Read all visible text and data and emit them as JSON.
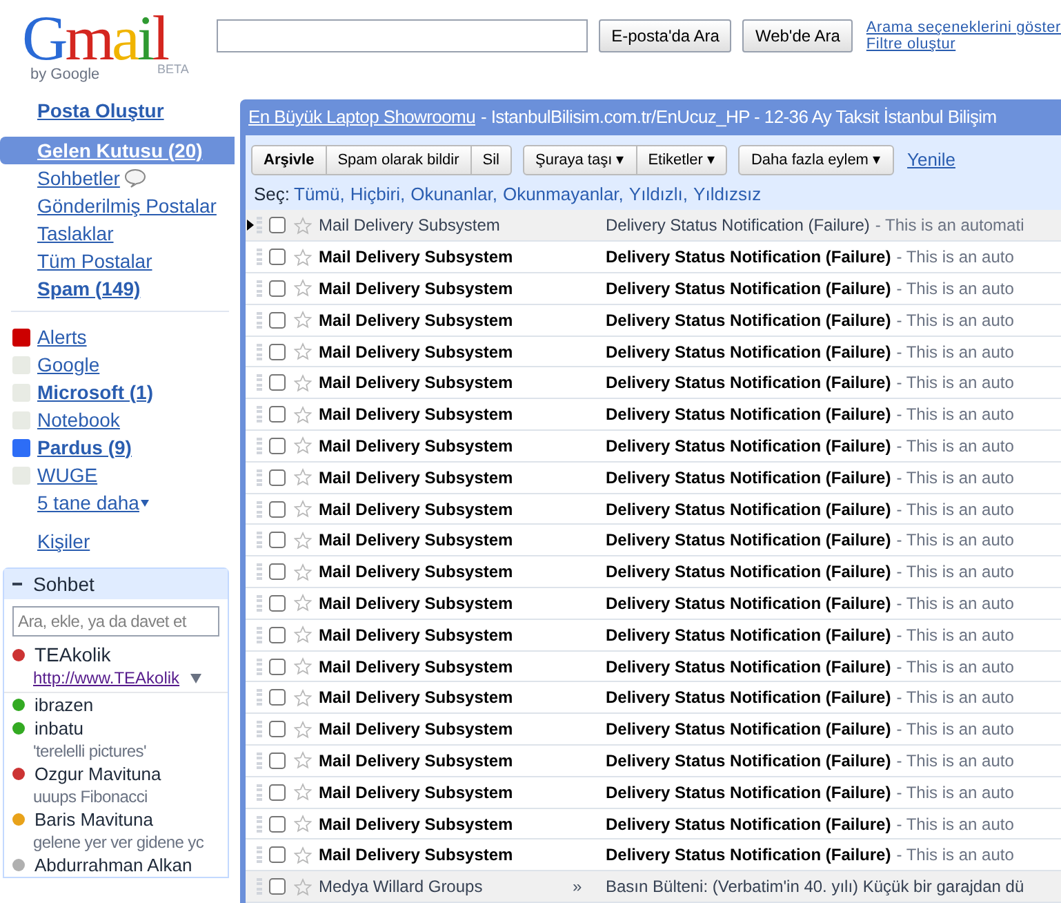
{
  "logo": {
    "text": "Gmail",
    "byline": "by Google",
    "badge": "BETA"
  },
  "search": {
    "buttons": [
      "E-posta'da Ara",
      "Web'de Ara"
    ],
    "links": [
      "Arama seçeneklerini göster",
      "Filtre oluştur"
    ]
  },
  "compose": "Posta Oluştur",
  "nav": [
    {
      "label": "Gelen Kutusu (20)",
      "bold": true,
      "selected": true,
      "kind": "folder"
    },
    {
      "label": "Sohbetler",
      "bold": false,
      "selected": false,
      "kind": "chat"
    },
    {
      "label": "Gönderilmiş Postalar",
      "bold": false,
      "selected": false,
      "kind": "folder"
    },
    {
      "label": "Taslaklar",
      "bold": false,
      "selected": false,
      "kind": "folder"
    },
    {
      "label": "Tüm Postalar",
      "bold": false,
      "selected": false,
      "kind": "folder"
    },
    {
      "label": "Spam (149)",
      "bold": true,
      "selected": false,
      "kind": "folder"
    }
  ],
  "labels": [
    {
      "label": "Alerts",
      "bold": false,
      "color": "#cc0000"
    },
    {
      "label": "Google",
      "bold": false,
      "color": "#e8ebe4"
    },
    {
      "label": "Microsoft (1)",
      "bold": true,
      "color": "#e8ebe4"
    },
    {
      "label": "Notebook",
      "bold": false,
      "color": "#e8ebe4"
    },
    {
      "label": "Pardus (9)",
      "bold": true,
      "color": "#2d6df6"
    },
    {
      "label": "WUGE",
      "bold": false,
      "color": "#e8ebe4"
    }
  ],
  "more_labels": "5 tane daha",
  "contacts_link": "Kişiler",
  "chat": {
    "title": "Sohbet",
    "expanded": true,
    "placeholder": "Ara, ekle, ya da davet et",
    "me": {
      "name": "TEAkolik",
      "color": "#cc3333",
      "status": "http://www.TEAkolik"
    },
    "contacts": [
      {
        "name": "ibrazen",
        "color": "#33aa22"
      },
      {
        "name": "inbatu",
        "color": "#33aa22",
        "status": "'terelelli pictures'"
      },
      {
        "name": "Ozgur Mavituna",
        "color": "#cc3333",
        "status": "uuups Fibonacci"
      },
      {
        "name": "Baris Mavituna",
        "color": "#e8a21a",
        "status": "gelene yer ver gidene yc"
      },
      {
        "name": "Abdurrahman Alkan",
        "color": "#b0b0b0"
      }
    ]
  },
  "ad": {
    "link": "En Büyük Laptop Showroomu",
    "text": "- IstanbulBilisim.com.tr/EnUcuz_HP - 12-36 Ay Taksit İstanbul Bilişim"
  },
  "toolbar": {
    "groups": [
      [
        "Arşivle",
        "Spam olarak bildir",
        "Sil"
      ],
      [
        "Şuraya taşı ▾",
        "Etiketler ▾"
      ],
      [
        "Daha fazla eylem ▾"
      ]
    ],
    "refresh": "Yenile"
  },
  "select": {
    "label": "Seç:",
    "options": [
      "Tümü,",
      "Hiçbiri,",
      "Okunanlar,",
      "Okunmayanlar,",
      "Yıldızlı,",
      "Yıldızsız"
    ]
  },
  "emails": [
    {
      "sender": "Mail Delivery Subsystem",
      "subject": "Delivery Status Notification (Failure)",
      "snippet": "- This is an automati",
      "unread": false,
      "current": true,
      "checked": false,
      "starred": false
    },
    {
      "sender": "Mail Delivery Subsystem",
      "subject": "Delivery Status Notification (Failure)",
      "snippet": "- This is an auto",
      "unread": true,
      "current": false,
      "checked": false,
      "starred": false
    },
    {
      "sender": "Mail Delivery Subsystem",
      "subject": "Delivery Status Notification (Failure)",
      "snippet": "- This is an auto",
      "unread": true,
      "current": false,
      "checked": false,
      "starred": false
    },
    {
      "sender": "Mail Delivery Subsystem",
      "subject": "Delivery Status Notification (Failure)",
      "snippet": "- This is an auto",
      "unread": true,
      "current": false,
      "checked": false,
      "starred": false
    },
    {
      "sender": "Mail Delivery Subsystem",
      "subject": "Delivery Status Notification (Failure)",
      "snippet": "- This is an auto",
      "unread": true,
      "current": false,
      "checked": false,
      "starred": false
    },
    {
      "sender": "Mail Delivery Subsystem",
      "subject": "Delivery Status Notification (Failure)",
      "snippet": "- This is an auto",
      "unread": true,
      "current": false,
      "checked": false,
      "starred": false
    },
    {
      "sender": "Mail Delivery Subsystem",
      "subject": "Delivery Status Notification (Failure)",
      "snippet": "- This is an auto",
      "unread": true,
      "current": false,
      "checked": false,
      "starred": false
    },
    {
      "sender": "Mail Delivery Subsystem",
      "subject": "Delivery Status Notification (Failure)",
      "snippet": "- This is an auto",
      "unread": true,
      "current": false,
      "checked": false,
      "starred": false
    },
    {
      "sender": "Mail Delivery Subsystem",
      "subject": "Delivery Status Notification (Failure)",
      "snippet": "- This is an auto",
      "unread": true,
      "current": false,
      "checked": false,
      "starred": false
    },
    {
      "sender": "Mail Delivery Subsystem",
      "subject": "Delivery Status Notification (Failure)",
      "snippet": "- This is an auto",
      "unread": true,
      "current": false,
      "checked": false,
      "starred": false
    },
    {
      "sender": "Mail Delivery Subsystem",
      "subject": "Delivery Status Notification (Failure)",
      "snippet": "- This is an auto",
      "unread": true,
      "current": false,
      "checked": false,
      "starred": false
    },
    {
      "sender": "Mail Delivery Subsystem",
      "subject": "Delivery Status Notification (Failure)",
      "snippet": "- This is an auto",
      "unread": true,
      "current": false,
      "checked": false,
      "starred": false
    },
    {
      "sender": "Mail Delivery Subsystem",
      "subject": "Delivery Status Notification (Failure)",
      "snippet": "- This is an auto",
      "unread": true,
      "current": false,
      "checked": false,
      "starred": false
    },
    {
      "sender": "Mail Delivery Subsystem",
      "subject": "Delivery Status Notification (Failure)",
      "snippet": "- This is an auto",
      "unread": true,
      "current": false,
      "checked": false,
      "starred": false
    },
    {
      "sender": "Mail Delivery Subsystem",
      "subject": "Delivery Status Notification (Failure)",
      "snippet": "- This is an auto",
      "unread": true,
      "current": false,
      "checked": false,
      "starred": false
    },
    {
      "sender": "Mail Delivery Subsystem",
      "subject": "Delivery Status Notification (Failure)",
      "snippet": "- This is an auto",
      "unread": true,
      "current": false,
      "checked": false,
      "starred": false
    },
    {
      "sender": "Mail Delivery Subsystem",
      "subject": "Delivery Status Notification (Failure)",
      "snippet": "- This is an auto",
      "unread": true,
      "current": false,
      "checked": false,
      "starred": false
    },
    {
      "sender": "Mail Delivery Subsystem",
      "subject": "Delivery Status Notification (Failure)",
      "snippet": "- This is an auto",
      "unread": true,
      "current": false,
      "checked": false,
      "starred": false
    },
    {
      "sender": "Mail Delivery Subsystem",
      "subject": "Delivery Status Notification (Failure)",
      "snippet": "- This is an auto",
      "unread": true,
      "current": false,
      "checked": false,
      "starred": false
    },
    {
      "sender": "Mail Delivery Subsystem",
      "subject": "Delivery Status Notification (Failure)",
      "snippet": "- This is an auto",
      "unread": true,
      "current": false,
      "checked": false,
      "starred": false
    },
    {
      "sender": "Mail Delivery Subsystem",
      "subject": "Delivery Status Notification (Failure)",
      "snippet": "- This is an auto",
      "unread": true,
      "current": false,
      "checked": false,
      "starred": false
    },
    {
      "sender": "Medya Willard Groups",
      "marker": "»",
      "subject": "Basın Bülteni: (Verbatim'in 40. yılı) Küçük bir garajdan dü",
      "unread": false,
      "current": false,
      "checked": false,
      "starred": false
    }
  ]
}
